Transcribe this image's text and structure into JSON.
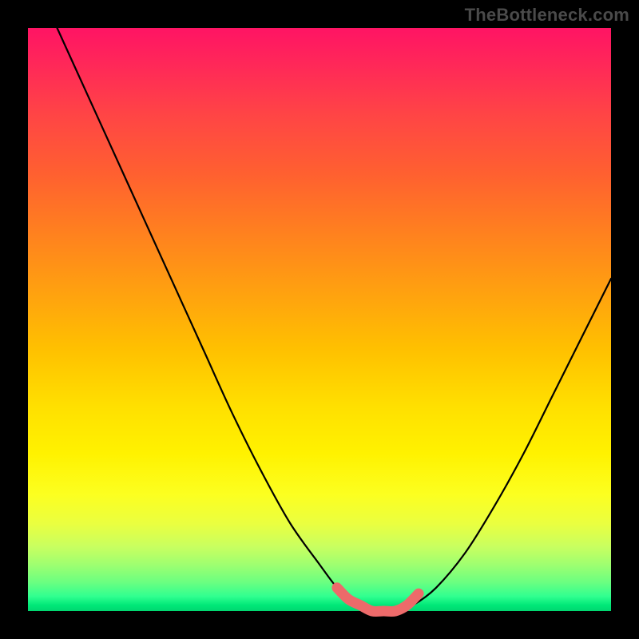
{
  "attribution": "TheBottleneck.com",
  "chart_data": {
    "type": "line",
    "title": "",
    "xlabel": "",
    "ylabel": "",
    "xlim": [
      0,
      100
    ],
    "ylim": [
      0,
      100
    ],
    "series": [
      {
        "name": "bottleneck-curve",
        "color": "#000000",
        "x": [
          5,
          10,
          15,
          20,
          25,
          30,
          35,
          40,
          45,
          50,
          53,
          56,
          60,
          63,
          66,
          70,
          75,
          80,
          85,
          90,
          95,
          100
        ],
        "values": [
          100,
          89,
          78,
          67,
          56,
          45,
          34,
          24,
          15,
          8,
          4,
          1,
          0,
          0,
          1,
          4,
          10,
          18,
          27,
          37,
          47,
          57
        ]
      },
      {
        "name": "optimal-zone",
        "color": "#ed6a6a",
        "x": [
          53,
          55,
          57,
          59,
          61,
          63,
          65,
          67
        ],
        "values": [
          4,
          2,
          1,
          0,
          0,
          0,
          1,
          3
        ]
      }
    ],
    "annotations": []
  },
  "colors": {
    "frame": "#000000",
    "curve": "#000000",
    "highlight": "#ed6a6a"
  }
}
